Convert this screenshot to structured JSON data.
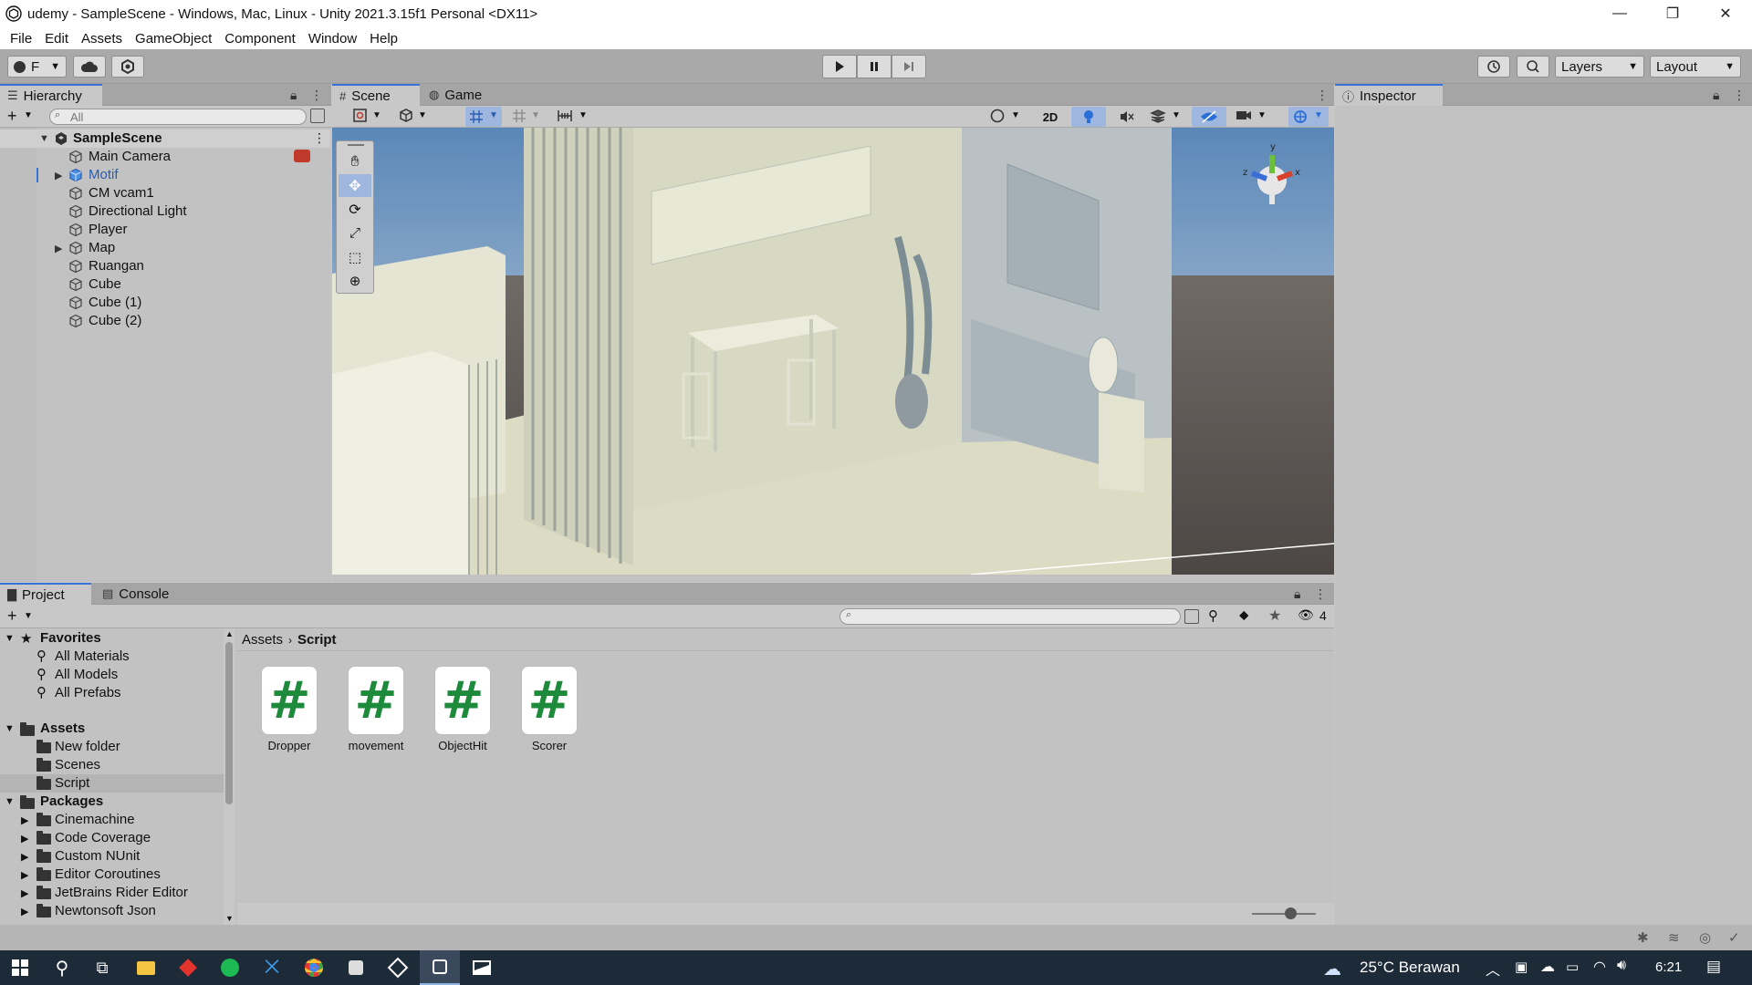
{
  "window": {
    "title": "udemy - SampleScene - Windows, Mac, Linux - Unity 2021.3.15f1 Personal <DX11>",
    "minimize": "—",
    "maximize": "❐",
    "close": "✕"
  },
  "menu": [
    "File",
    "Edit",
    "Assets",
    "GameObject",
    "Component",
    "Window",
    "Help"
  ],
  "toolbar": {
    "account_label": "F",
    "layers_label": "Layers",
    "layout_label": "Layout"
  },
  "hierarchy": {
    "tab_label": "Hierarchy",
    "search_placeholder": "All",
    "scene_name": "SampleScene",
    "items": [
      {
        "label": "Main Camera",
        "expandable": false,
        "selected": false
      },
      {
        "label": "Motif",
        "expandable": true,
        "selected": true
      },
      {
        "label": "CM vcam1",
        "expandable": false,
        "selected": false
      },
      {
        "label": "Directional Light",
        "expandable": false,
        "selected": false
      },
      {
        "label": "Player",
        "expandable": false,
        "selected": false
      },
      {
        "label": "Map",
        "expandable": true,
        "selected": false
      },
      {
        "label": "Ruangan",
        "expandable": false,
        "selected": false
      },
      {
        "label": "Cube",
        "expandable": false,
        "selected": false
      },
      {
        "label": "Cube (1)",
        "expandable": false,
        "selected": false
      },
      {
        "label": "Cube (2)",
        "expandable": false,
        "selected": false
      }
    ]
  },
  "scene": {
    "tab_scene": "Scene",
    "tab_game": "Game",
    "btn_2d": "2D"
  },
  "inspector": {
    "tab_label": "Inspector"
  },
  "project": {
    "tab_project": "Project",
    "tab_console": "Console",
    "hidden_count": "4",
    "breadcrumb_root": "Assets",
    "breadcrumb_current": "Script",
    "favorites_label": "Favorites",
    "favorites": [
      "All Materials",
      "All Models",
      "All Prefabs"
    ],
    "assets_label": "Assets",
    "assets_folders": [
      "New folder",
      "Scenes",
      "Script"
    ],
    "packages_label": "Packages",
    "packages": [
      "Cinemachine",
      "Code Coverage",
      "Custom NUnit",
      "Editor Coroutines",
      "JetBrains Rider Editor",
      "Newtonsoft Json"
    ],
    "files": [
      "Dropper",
      "movement",
      "ObjectHit",
      "Scorer"
    ],
    "file_glyph": "#"
  },
  "taskbar": {
    "weather": "25°C  Berawan",
    "time": "6:21"
  },
  "colors": {
    "accent": "#3a72d8",
    "script_icon": "#1e8a3c",
    "selection": "#9fb7de"
  }
}
